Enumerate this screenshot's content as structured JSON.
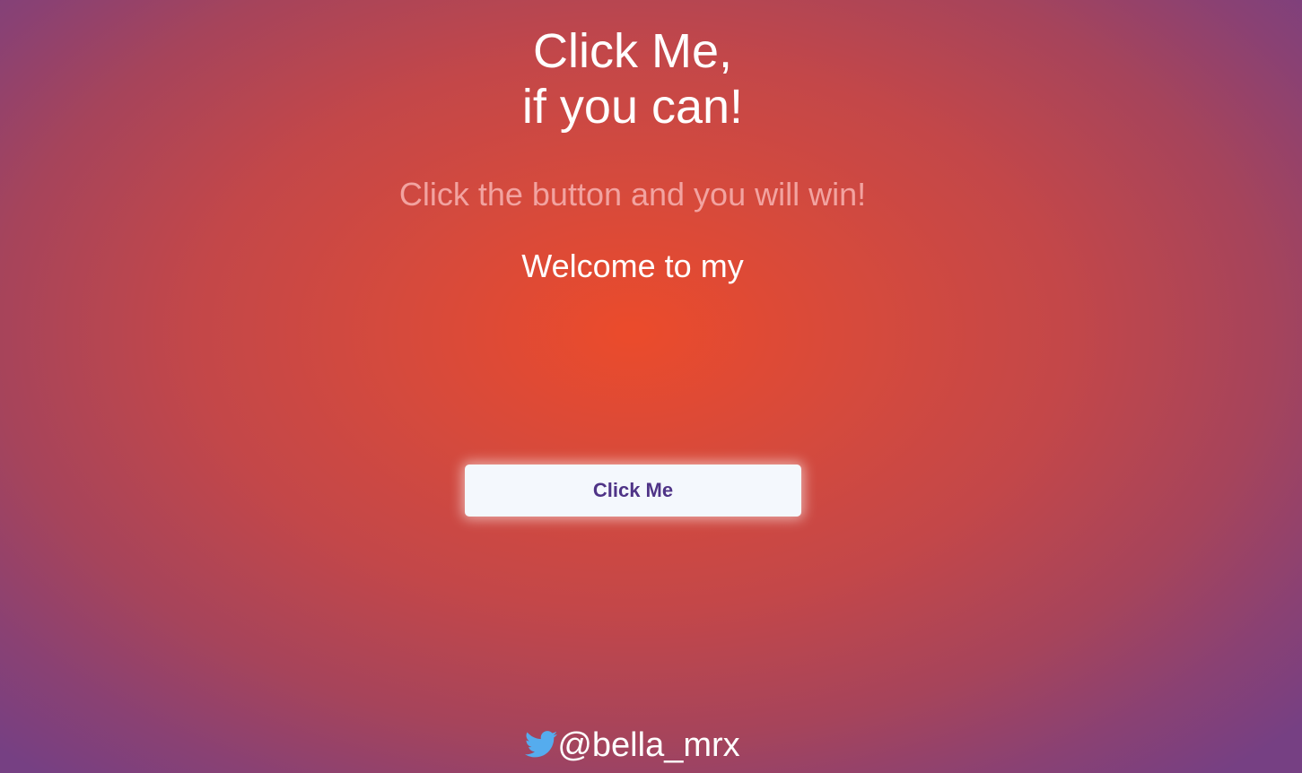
{
  "header": {
    "title_line1": "Click Me,",
    "title_line2": "if you can!"
  },
  "subtitle": "Click the button and you will win!",
  "welcome_text": "Welcome to my",
  "button": {
    "label": "Click Me"
  },
  "footer": {
    "icon": "twitter-bird-icon",
    "handle": "@bella_mrx"
  },
  "colors": {
    "center_glow": "#eb4b2b",
    "edge": "#764083",
    "subtitle": "#f2a3a0",
    "button_bg": "#f4f8fd",
    "button_text": "#4f3487",
    "twitter_blue": "#1da1f2"
  }
}
